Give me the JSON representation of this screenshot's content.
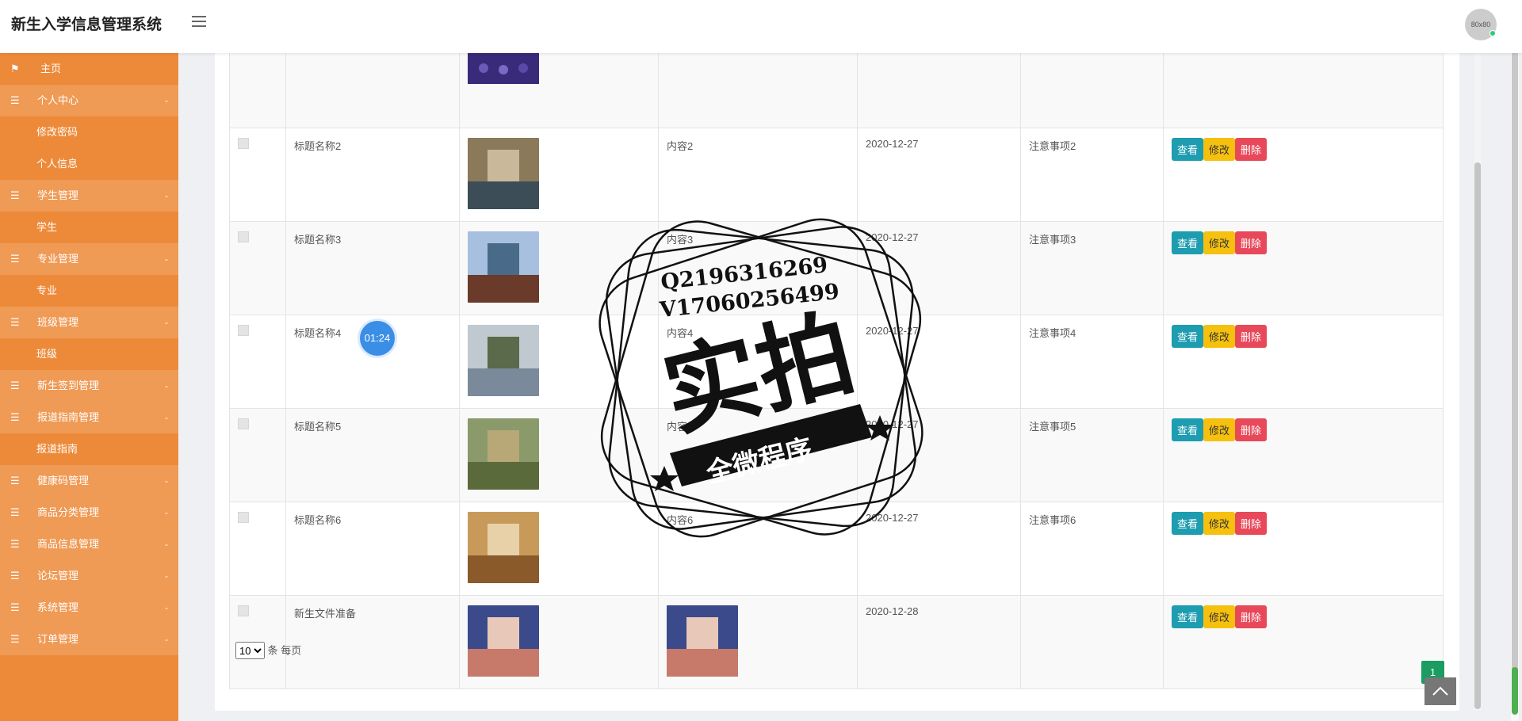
{
  "header": {
    "app_title": "新生入学信息管理系统",
    "avatar_text": "80x80"
  },
  "sidebar": {
    "items": [
      {
        "label": "主页",
        "type": "home",
        "icon": "flag-icon",
        "caret": ""
      },
      {
        "label": "个人中心",
        "type": "group",
        "icon": "list-icon",
        "caret": "-"
      },
      {
        "label": "修改密码",
        "type": "sub"
      },
      {
        "label": "个人信息",
        "type": "sub"
      },
      {
        "label": "学生管理",
        "type": "group",
        "icon": "list-icon",
        "caret": "-"
      },
      {
        "label": "学生",
        "type": "sub"
      },
      {
        "label": "专业管理",
        "type": "group",
        "icon": "list-icon",
        "caret": "-"
      },
      {
        "label": "专业",
        "type": "sub"
      },
      {
        "label": "班级管理",
        "type": "group",
        "icon": "list-icon",
        "caret": "-"
      },
      {
        "label": "班级",
        "type": "sub"
      },
      {
        "label": "新生签到管理",
        "type": "group",
        "icon": "list-icon",
        "caret": "-"
      },
      {
        "label": "报道指南管理",
        "type": "group",
        "icon": "list-icon",
        "caret": "-"
      },
      {
        "label": "报道指南",
        "type": "sub"
      },
      {
        "label": "健康码管理",
        "type": "group",
        "icon": "list-icon",
        "caret": "-"
      },
      {
        "label": "商品分类管理",
        "type": "group",
        "icon": "list-icon",
        "caret": "-"
      },
      {
        "label": "商品信息管理",
        "type": "group",
        "icon": "list-icon",
        "caret": "-"
      },
      {
        "label": "论坛管理",
        "type": "group",
        "icon": "list-icon",
        "caret": "-"
      },
      {
        "label": "系统管理",
        "type": "group",
        "icon": "list-icon",
        "caret": "-"
      },
      {
        "label": "订单管理",
        "type": "group",
        "icon": "list-icon",
        "caret": "-"
      }
    ]
  },
  "table": {
    "buttons": {
      "view": "查看",
      "edit": "修改",
      "delete": "删除"
    },
    "rows": [
      {
        "title": "标题名称2",
        "content": "内容2",
        "date": "2020-12-27",
        "notes": "注意事项2"
      },
      {
        "title": "标题名称3",
        "content": "内容3",
        "date": "2020-12-27",
        "notes": "注意事项3"
      },
      {
        "title": "标题名称4",
        "content": "内容4",
        "date": "2020-12-27",
        "notes": "注意事项4"
      },
      {
        "title": "标题名称5",
        "content": "内容5",
        "date": "2020-12-27",
        "notes": "注意事项5"
      },
      {
        "title": "标题名称6",
        "content": "内容6",
        "date": "2020-12-27",
        "notes": "注意事项6"
      },
      {
        "title": "新生文件准备",
        "content": "",
        "date": "2020-12-28",
        "notes": ""
      }
    ]
  },
  "pagination": {
    "page_size": "10",
    "per_page_text": "条 每页",
    "current_page": "1"
  },
  "overlay": {
    "timer": "01:24",
    "stamp_line1": "Q2196316269",
    "stamp_line2": "V17060256499",
    "stamp_big": "实拍",
    "stamp_banner": "全微程序"
  }
}
